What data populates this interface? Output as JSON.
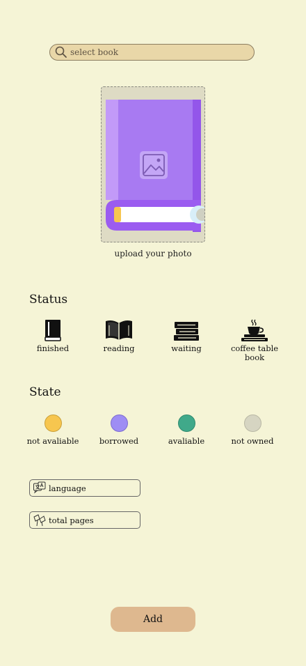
{
  "search": {
    "placeholder": "select book",
    "icon": "search-icon"
  },
  "upload": {
    "label": "upload your photo",
    "icon": "image-placeholder-icon"
  },
  "status": {
    "title": "Status",
    "options": [
      {
        "label": "finished",
        "icon": "closed-book-icon"
      },
      {
        "label": "reading",
        "icon": "open-book-icon"
      },
      {
        "label": "waiting",
        "icon": "book-stack-icon"
      },
      {
        "label": "coffee table book",
        "icon": "coffee-cup-on-books-icon"
      }
    ]
  },
  "state": {
    "title": "State",
    "options": [
      {
        "label": "not avaliable",
        "color": "#f7c64f"
      },
      {
        "label": "borrowed",
        "color": "#9e8df4"
      },
      {
        "label": "avaliable",
        "color": "#40a98a"
      },
      {
        "label": "not owned",
        "color": "#d6d5c2"
      }
    ]
  },
  "fields": {
    "language": {
      "label": "language",
      "icon": "translate-icon"
    },
    "pages": {
      "label": "total pages",
      "icon": "pages-icon"
    }
  },
  "add_button": {
    "label": "Add"
  }
}
